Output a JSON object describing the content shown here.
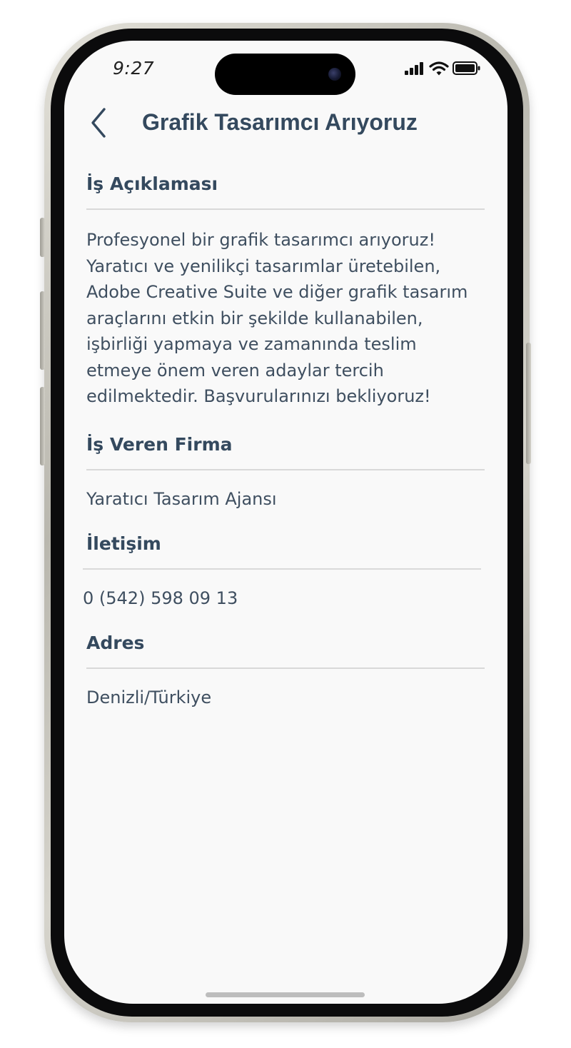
{
  "status_bar": {
    "time": "9:27",
    "signal_icon": "cellular-signal-icon",
    "wifi_icon": "wifi-icon",
    "battery_icon": "battery-icon"
  },
  "header": {
    "back_icon": "chevron-left-icon",
    "title": "Grafik Tasarımcı Arıyoruz"
  },
  "job_description": {
    "heading": "İş Açıklaması",
    "lines": [
      "Profesyonel bir grafik tasarımcı arıyoruz!",
      "Yaratıcı ve yenilikçi tasarımlar üretebilen,",
      "Adobe Creative Suite ve diğer grafik tasarım",
      "araçlarını etkin bir şekilde kullanabilen,",
      "işbirliği yapmaya ve zamanında teslim",
      "etmeye önem veren adaylar tercih",
      "edilmektedir. Başvurularınızı bekliyoruz!"
    ]
  },
  "employer": {
    "heading": "İş Veren Firma",
    "value": "Yaratıcı Tasarım Ajansı"
  },
  "contact": {
    "heading": "İletişim",
    "value": "0 (542) 598 09 13"
  },
  "address": {
    "heading": "Adres",
    "value": "Denizli/Türkiye"
  },
  "colors": {
    "heading_text": "#34495e",
    "body_text": "#3f4f60",
    "divider": "#d9d9d9",
    "screen_background": "#f9f9f9"
  }
}
